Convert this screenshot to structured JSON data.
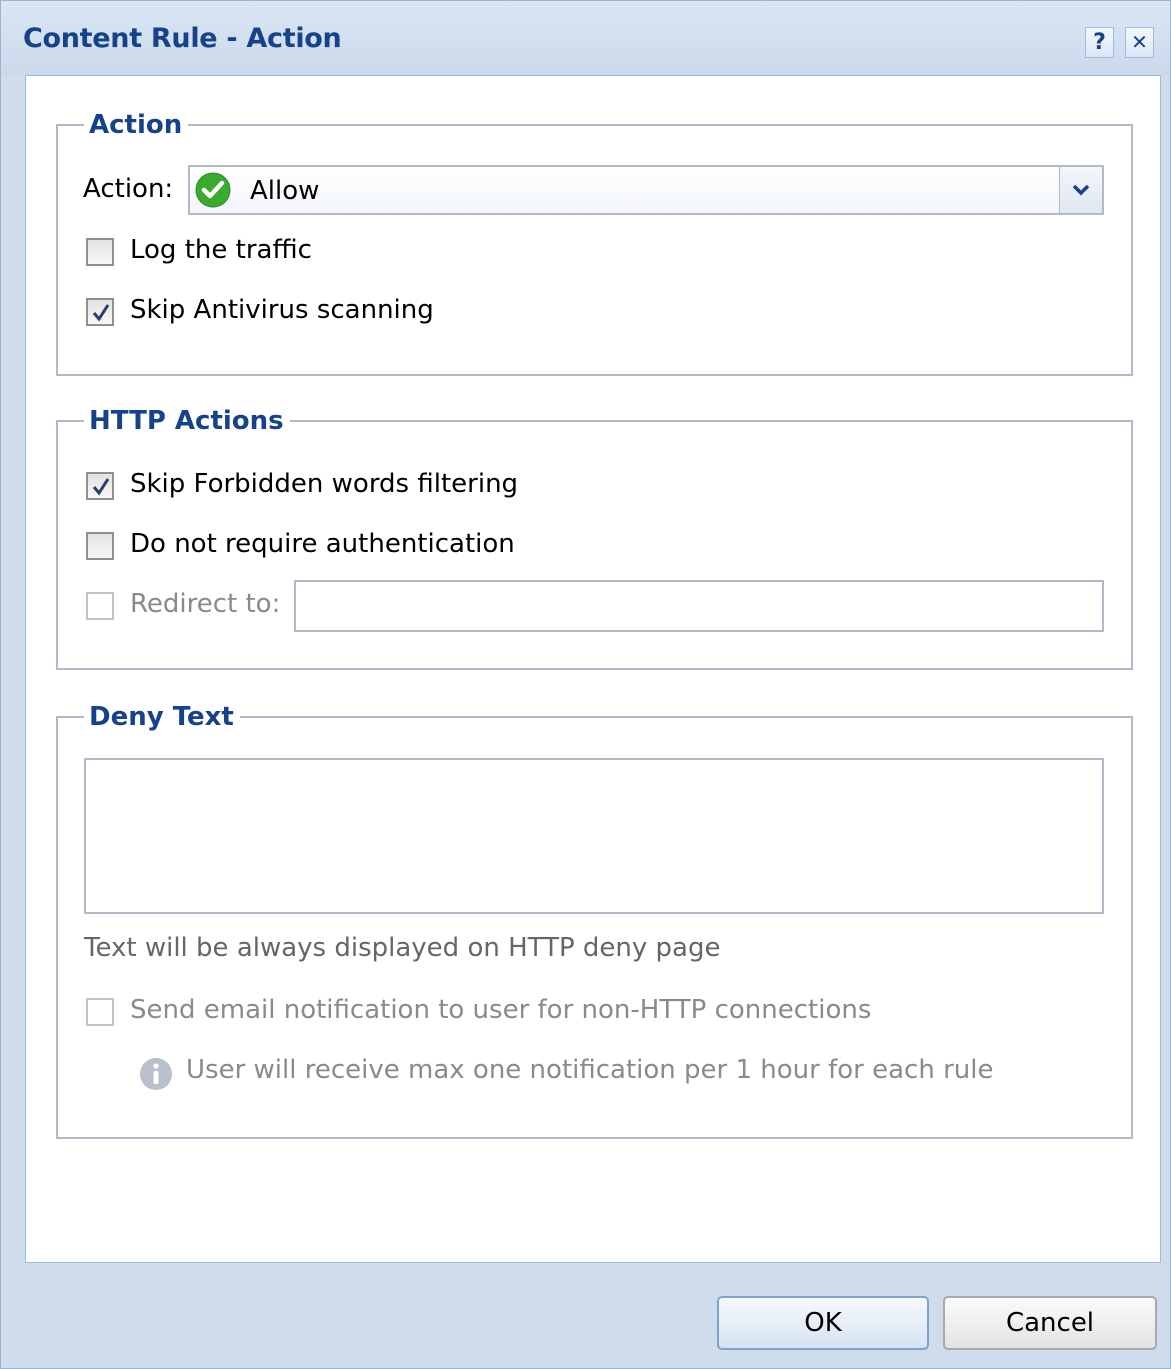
{
  "window": {
    "title": "Content Rule - Action",
    "help_label": "?",
    "close_label": "✕"
  },
  "action_group": {
    "legend": "Action",
    "action_label": "Action:",
    "action_value": "Allow",
    "action_icon": "green-check-circle-icon",
    "log_traffic": {
      "label": "Log the traffic",
      "checked": false
    },
    "skip_antivirus": {
      "label": "Skip Antivirus scanning",
      "checked": true
    }
  },
  "http_group": {
    "legend": "HTTP Actions",
    "skip_forbidden": {
      "label": "Skip Forbidden words filtering",
      "checked": true
    },
    "no_auth": {
      "label": "Do not require authentication",
      "checked": false
    },
    "redirect": {
      "label": "Redirect to:",
      "checked": false,
      "enabled": false,
      "value": ""
    }
  },
  "deny_group": {
    "legend": "Deny Text",
    "text_value": "",
    "hint": "Text will be always displayed on HTTP deny page",
    "email_notify": {
      "label": "Send email notification to user for non-HTTP connections",
      "checked": false,
      "enabled": false
    },
    "info": "User will receive max one notification per 1 hour for each rule"
  },
  "buttons": {
    "ok": "OK",
    "cancel": "Cancel"
  },
  "colors": {
    "title": "#15428b",
    "border": "#b5b8c8",
    "accent": "#99bbe8",
    "allow_green": "#3aab2f"
  }
}
